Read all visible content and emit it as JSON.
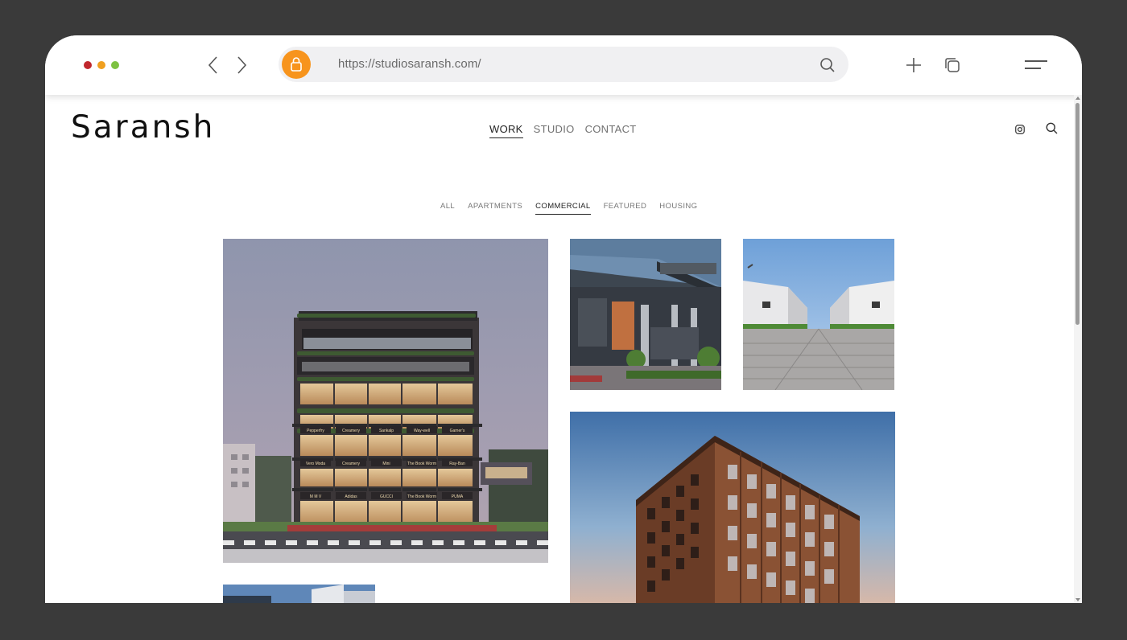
{
  "browser": {
    "url": "https://studiosaransh.com/",
    "colors": {
      "lock": "#f7941d",
      "dot_red": "#c1272d",
      "dot_yellow": "#f0a020",
      "dot_green": "#7ec242"
    }
  },
  "site": {
    "logo": "Saransh",
    "nav": [
      {
        "label": "WORK",
        "active": true
      },
      {
        "label": "STUDIO",
        "active": false
      },
      {
        "label": "CONTACT",
        "active": false
      }
    ]
  },
  "filters": [
    {
      "label": "ALL",
      "active": false
    },
    {
      "label": "APARTMENTS",
      "active": false
    },
    {
      "label": "COMMERCIAL",
      "active": true
    },
    {
      "label": "FEATURED",
      "active": false
    },
    {
      "label": "HOUSING",
      "active": false
    }
  ],
  "tiles": {
    "t1": {
      "signs_row1": [
        "Pepperfry",
        "Creamery",
        "Sankalp",
        "Way-well",
        "Gamer's"
      ],
      "signs_row2": [
        "Vero Moda",
        "Creamery",
        "Mini",
        "The Book Worm",
        "Ray-Ban"
      ],
      "signs_row3": [
        "M M V",
        "Adidas",
        "GUCCI",
        "The Book Worm",
        "PUMA"
      ]
    }
  }
}
